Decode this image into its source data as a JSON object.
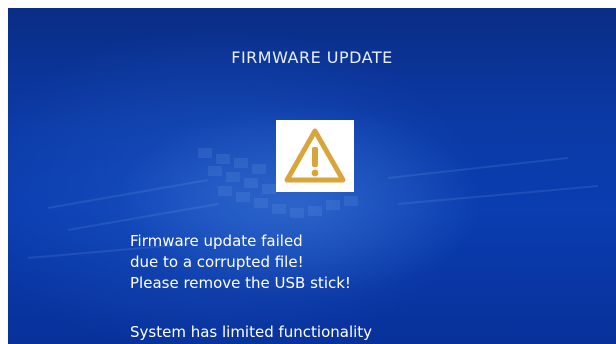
{
  "screen": {
    "title": "FIRMWARE UPDATE",
    "warning_icon": "warning-triangle-icon",
    "message_lines": [
      "Firmware update failed",
      "due to a corrupted file!",
      "Please remove the USB stick!"
    ],
    "status": "System has limited functionality"
  },
  "colors": {
    "background_top": "#0a2d86",
    "background_mid": "#0b3aa6",
    "warning_fill": "#ffffff",
    "warning_stroke": "#d9a43a"
  }
}
